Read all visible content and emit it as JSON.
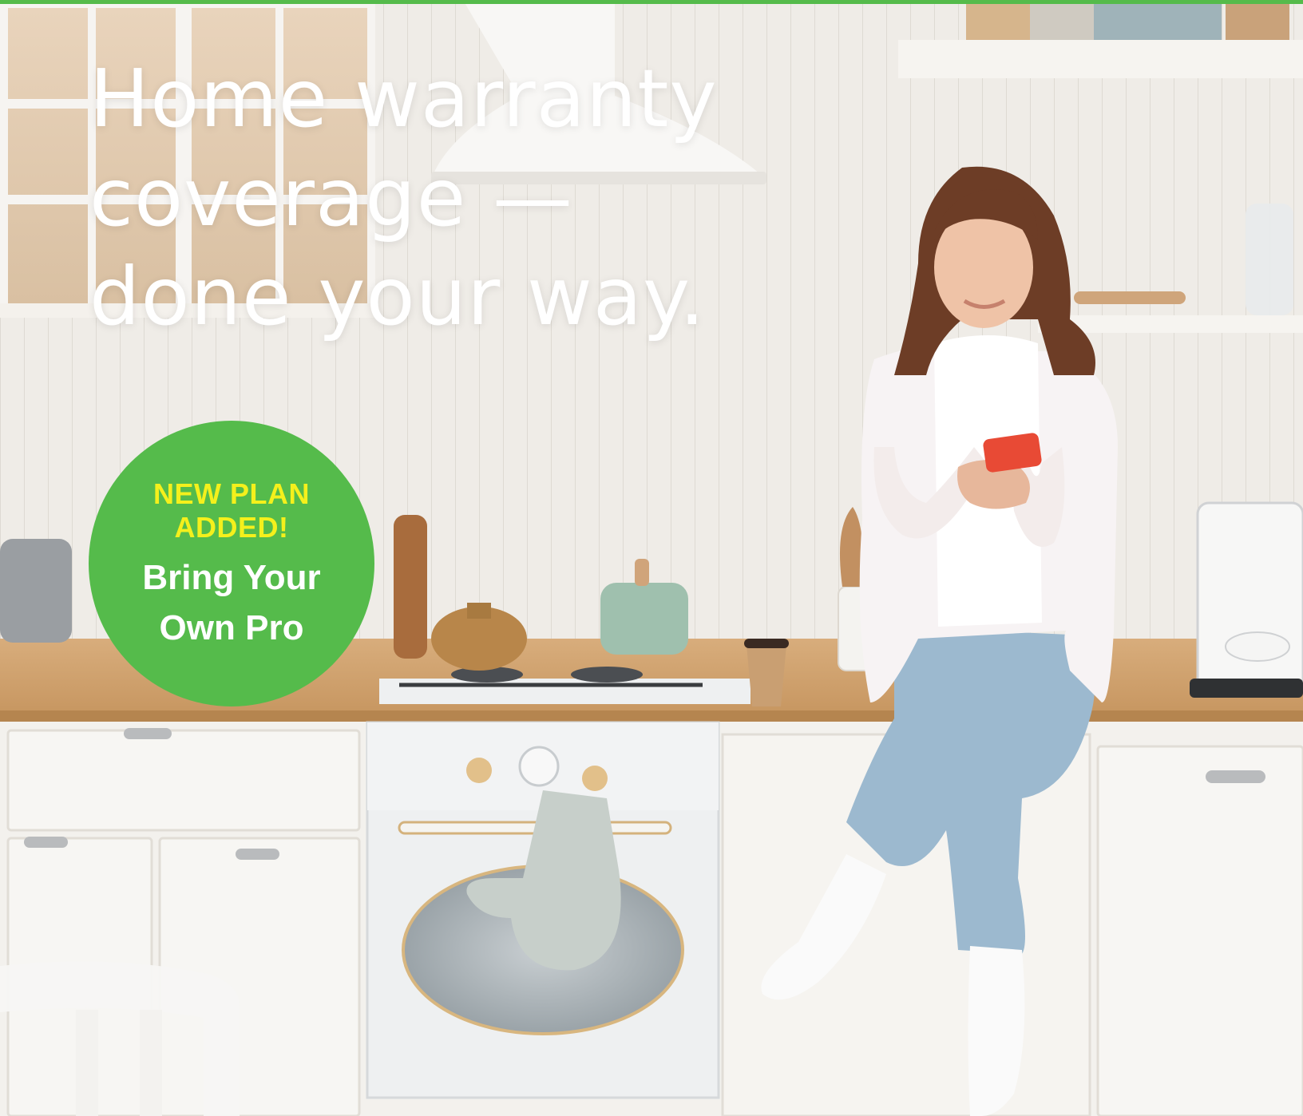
{
  "headline": {
    "line1": "Home warranty",
    "line2": "coverage —",
    "line3": "done your way."
  },
  "badge": {
    "tag_line1": "NEW PLAN",
    "tag_line2": "ADDED!",
    "name_line1": "Bring Your",
    "name_line2": "Own Pro"
  },
  "colors": {
    "brand_green": "#55bb4b",
    "tag_yellow": "#f4f01c",
    "headline_text": "#ffffff"
  },
  "photo": {
    "icon": "kitchen-photo-woman-with-phone"
  }
}
